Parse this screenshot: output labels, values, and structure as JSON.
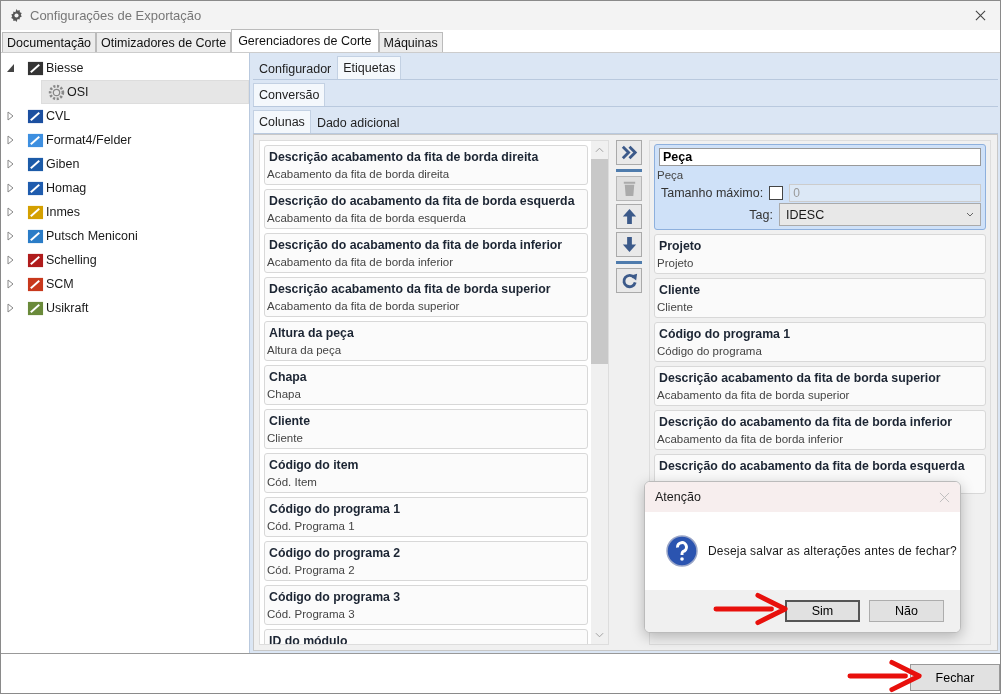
{
  "window": {
    "title": "Configurações de Exportação"
  },
  "tabs": [
    {
      "label": "Documentação",
      "selected": false
    },
    {
      "label": "Otimizadores de Corte",
      "selected": false
    },
    {
      "label": "Gerenciadores de Corte",
      "selected": true
    },
    {
      "label": "Máquinas",
      "selected": false
    }
  ],
  "tree": [
    {
      "label": "Biesse",
      "expanded": true,
      "selected": false,
      "children": [
        {
          "label": "OSI",
          "selected": true
        }
      ]
    },
    {
      "label": "CVL",
      "expanded": false,
      "selected": false
    },
    {
      "label": "Format4/Felder",
      "expanded": false,
      "selected": false
    },
    {
      "label": "Giben",
      "expanded": false,
      "selected": false
    },
    {
      "label": "Homag",
      "expanded": false,
      "selected": false
    },
    {
      "label": "Inmes",
      "expanded": false,
      "selected": false
    },
    {
      "label": "Putsch Meniconi",
      "expanded": false,
      "selected": false
    },
    {
      "label": "Schelling",
      "expanded": false,
      "selected": false
    },
    {
      "label": "SCM",
      "expanded": false,
      "selected": false
    },
    {
      "label": "Usikraft",
      "expanded": false,
      "selected": false
    }
  ],
  "sub_tabs": [
    {
      "label": "Configurador",
      "selected": false
    },
    {
      "label": "Etiquetas",
      "selected": true
    }
  ],
  "conversion_tabs": [
    {
      "label": "Conversão",
      "selected": true
    }
  ],
  "column_tabs": [
    {
      "label": "Colunas",
      "selected": true
    },
    {
      "label": "Dado adicional",
      "selected": false
    }
  ],
  "available_columns": [
    {
      "title": "Descrição acabamento da fita de borda direita",
      "subtitle": "Acabamento da fita de borda direita"
    },
    {
      "title": "Descrição do acabamento da fita de borda esquerda",
      "subtitle": "Acabamento da fita de borda esquerda"
    },
    {
      "title": "Descrição do acabamento da fita de borda inferior",
      "subtitle": "Acabamento da fita de borda inferior"
    },
    {
      "title": "Descrição acabamento da fita de borda superior",
      "subtitle": "Acabamento da fita de borda superior"
    },
    {
      "title": "Altura da peça",
      "subtitle": "Altura da peça"
    },
    {
      "title": "Chapa",
      "subtitle": "Chapa"
    },
    {
      "title": "Cliente",
      "subtitle": "Cliente"
    },
    {
      "title": "Código do item",
      "subtitle": "Cód. Item"
    },
    {
      "title": "Código do programa 1",
      "subtitle": "Cód. Programa 1"
    },
    {
      "title": "Código do programa 2",
      "subtitle": "Cód. Programa 2"
    },
    {
      "title": "Código do programa 3",
      "subtitle": "Cód. Programa 3"
    },
    {
      "title": "ID do módulo"
    }
  ],
  "toolbar": [
    {
      "kind": "add_all",
      "disabled": false
    },
    {
      "kind": "delete",
      "disabled": true
    },
    {
      "kind": "up",
      "disabled": false
    },
    {
      "kind": "down",
      "disabled": false
    },
    {
      "kind": "refresh",
      "disabled": false
    }
  ],
  "selected_columns": [
    {
      "title": "Peça",
      "subtitle": "Peça",
      "selected": true,
      "max_length_label": "Tamanho máximo:",
      "max_length_checked": false,
      "max_length_value": "0",
      "tag_label": "Tag:",
      "tag_value": "IDESC"
    },
    {
      "title": "Projeto",
      "subtitle": "Projeto",
      "selected": false
    },
    {
      "title": "Cliente",
      "subtitle": "Cliente",
      "selected": false
    },
    {
      "title": "Código do programa 1",
      "subtitle": "Código do programa",
      "selected": false
    },
    {
      "title": "Descrição acabamento da fita de borda superior",
      "subtitle": "Acabamento da fita de borda superior",
      "selected": false
    },
    {
      "title": "Descrição do acabamento da fita de borda inferior",
      "subtitle": "Acabamento da fita de borda inferior",
      "selected": false
    },
    {
      "title": "Descrição do acabamento da fita de borda esquerda",
      "selected": false
    }
  ],
  "dialog": {
    "title": "Atenção",
    "message": "Deseja salvar as alterações antes de fechar?",
    "buttons": [
      {
        "label": "Sim",
        "default": true
      },
      {
        "label": "Não",
        "default": false
      }
    ]
  },
  "footer": {
    "close_button": "Fechar"
  }
}
